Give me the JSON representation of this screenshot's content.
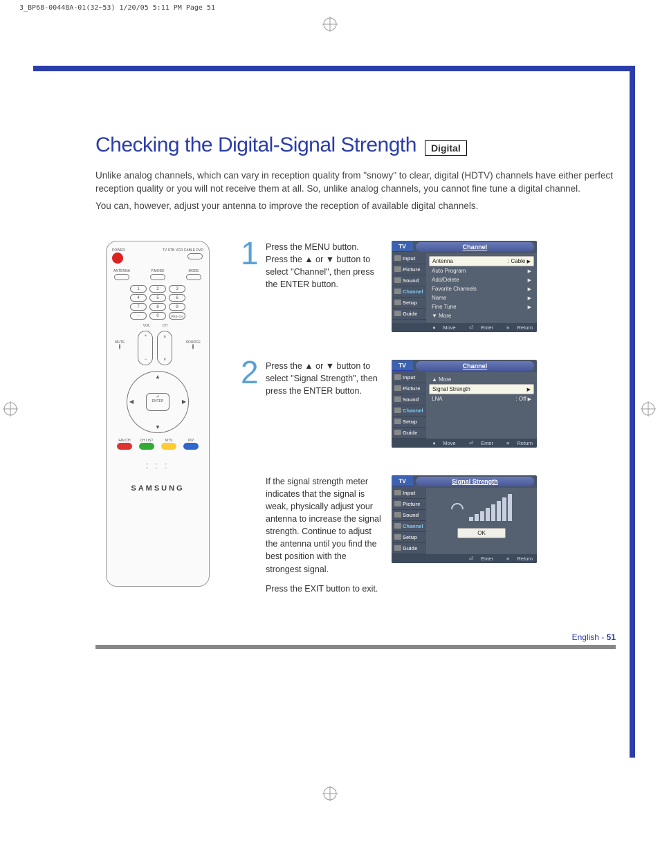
{
  "print_header": "3_BP68-00448A-01(32~53)  1/20/05  5:11 PM  Page 51",
  "title": "Checking the Digital-Signal Strength",
  "badge": "Digital",
  "intro": {
    "p1": "Unlike analog channels, which can vary in reception quality from \"snowy\" to clear, digital (HDTV) channels have either perfect reception quality or you will not receive them at all. So, unlike analog channels, you cannot fine tune a digital channel.",
    "p2": "You can, however, adjust your antenna to improve the reception of available digital channels."
  },
  "steps": [
    {
      "num": "1",
      "text": "Press the MENU button. Press the ▲ or ▼ button to select \"Channel\", then press the ENTER button."
    },
    {
      "num": "2",
      "text": "Press the ▲ or ▼ button to select \"Signal Strength\", then press the ENTER button."
    },
    {
      "num": "",
      "text_p1": "If the signal strength meter indicates that the signal is weak, physically adjust your antenna to increase the signal strength. Continue to adjust the antenna until you find the best position with the strongest signal.",
      "text_p2": "Press the EXIT button to exit."
    }
  ],
  "osd_labels": {
    "tv": "TV",
    "side": [
      "Input",
      "Picture",
      "Sound",
      "Channel",
      "Setup",
      "Guide"
    ],
    "footer_move": "Move",
    "footer_enter": "Enter",
    "footer_return": "Return"
  },
  "osd1": {
    "title": "Channel",
    "rows": [
      {
        "l": "Antenna",
        "r": ": Cable",
        "a": "▶",
        "sel": true
      },
      {
        "l": "Auto Program",
        "r": "",
        "a": "▶"
      },
      {
        "l": "Add/Delete",
        "r": "",
        "a": "▶"
      },
      {
        "l": "Favorite Channels",
        "r": "",
        "a": "▶"
      },
      {
        "l": "Name",
        "r": "",
        "a": "▶"
      },
      {
        "l": "Fine Tune",
        "r": "",
        "a": "▶"
      },
      {
        "l": "▼ More",
        "r": "",
        "a": ""
      }
    ]
  },
  "osd2": {
    "title": "Channel",
    "rows": [
      {
        "l": "▲ More",
        "r": "",
        "a": ""
      },
      {
        "l": "Signal Strength",
        "r": "",
        "a": "▶",
        "sel": true
      },
      {
        "l": "LNA",
        "r": ": Off",
        "a": "▶"
      }
    ]
  },
  "osd3": {
    "title": "Signal Strength",
    "ok": "OK"
  },
  "remote": {
    "power": "POWER",
    "modes": "TV  STB  VCR  CABLE  DVD",
    "row1": [
      "ANTENNA",
      "P.MODE",
      "MODE"
    ],
    "nums": [
      [
        "1",
        "2",
        "3"
      ],
      [
        "4",
        "5",
        "6"
      ],
      [
        "7",
        "8",
        "9"
      ],
      [
        "-",
        "0",
        "PRE-CH"
      ]
    ],
    "vol": "VOL",
    "ch": "CH",
    "mute": "MUTE",
    "source": "SOURCE",
    "enter": "ENTER",
    "color_row": [
      "FAV.CH",
      "CH LIST",
      "MTS",
      "PIP"
    ],
    "brand": "SAMSUNG"
  },
  "footer": {
    "lang": "English -",
    "page": "51"
  }
}
